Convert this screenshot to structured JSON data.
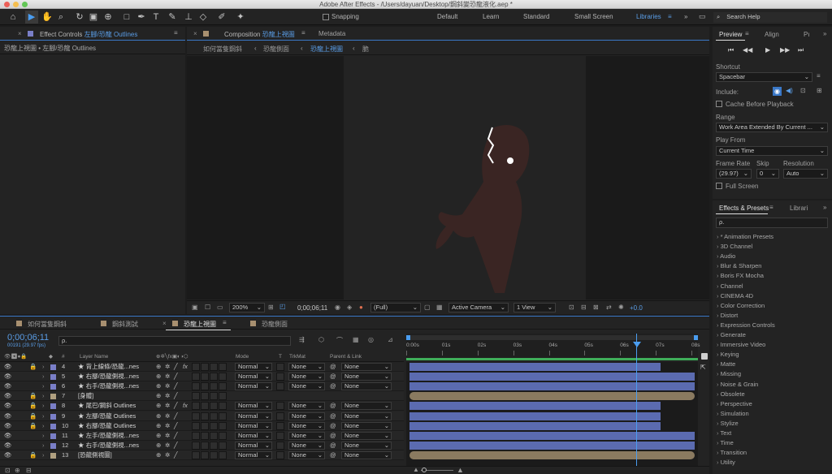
{
  "window_title": "Adobe After Effects - /Users/dayuan/Desktop/鋼斜變恐龍液化.aep *",
  "toolbar": {
    "snapping": "Snapping",
    "workspaces": [
      "Default",
      "Learn",
      "Standard",
      "Small Screen",
      "Libraries"
    ],
    "active_workspace": "Libraries",
    "search_help": "Search Help"
  },
  "effect_controls": {
    "tab_prefix": "Effect Controls",
    "tab_name": "左腳/恐龍 Outlines",
    "subtitle": "恐龍上視圖 • 左腳/恐龍 Outlines"
  },
  "composition": {
    "tab_prefix": "Composition",
    "tab_name": "恐龍上視圖",
    "metadata_tab": "Metadata",
    "crumbs": [
      "如何當隻鋼斜",
      "恐龍側面",
      "恐龍上視圖",
      "脆"
    ],
    "zoom": "200%",
    "timecode": "0;00;06;11",
    "resolution": "(Full)",
    "camera": "Active Camera",
    "views": "1 View",
    "exposure": "+0.0"
  },
  "timeline": {
    "tabs": [
      "如何當隻鋼斜",
      "鋼斜測試",
      "恐龍上視圖",
      "恐龍側面"
    ],
    "active_tab": "恐龍上視圖",
    "current_time": "0;00;06;11",
    "fps_info": "00191 (29.97 fps)",
    "search_placeholder": "ρ.",
    "headers": {
      "num": "#",
      "layer_name": "Layer Name",
      "mode": "Mode",
      "t": "T",
      "trkmat": "TrkMat",
      "parent": "Parent & Link"
    },
    "ruler": [
      "0:00s",
      "01s",
      "02s",
      "03s",
      "04s",
      "05s",
      "06s",
      "07s",
      "08s"
    ],
    "layers": [
      {
        "num": "4",
        "name": "★ 背上線條/恐龍...nes",
        "mode": "Normal",
        "trkmat": "None",
        "parent": "None",
        "lock": true,
        "fx": true,
        "color": "#7a7fc8",
        "bar_end": 0.88,
        "bar_color": "#5b6bb0"
      },
      {
        "num": "5",
        "name": "★ 右腳/恐龍側視...nes",
        "mode": "Normal",
        "trkmat": "None",
        "parent": "None",
        "lock": false,
        "fx": false,
        "color": "#7a7fc8",
        "bar_end": 1.0,
        "bar_color": "#5b6bb0"
      },
      {
        "num": "6",
        "name": "★ 右手/恐龍側視...nes",
        "mode": "Normal",
        "trkmat": "None",
        "parent": "None",
        "lock": false,
        "fx": false,
        "color": "#7a7fc8",
        "bar_end": 1.0,
        "bar_color": "#5b6bb0"
      },
      {
        "num": "7",
        "name": "[身體]",
        "mode": "",
        "trkmat": "",
        "parent": "",
        "lock": true,
        "fx": false,
        "color": "#b0a080",
        "bar_end": 1.0,
        "bar_color": "#8a7a60"
      },
      {
        "num": "8",
        "name": "★ 尾巴/鋼斜 Outlines",
        "mode": "Normal",
        "trkmat": "None",
        "parent": "None",
        "lock": true,
        "fx": true,
        "color": "#7a7fc8",
        "bar_end": 0.88,
        "bar_color": "#5b6bb0"
      },
      {
        "num": "9",
        "name": "★ 左腳/恐龍 Outlines",
        "mode": "Normal",
        "trkmat": "None",
        "parent": "None",
        "lock": true,
        "fx": false,
        "color": "#7a7fc8",
        "bar_end": 0.88,
        "bar_color": "#5b6bb0"
      },
      {
        "num": "10",
        "name": "★ 右腳/恐龍 Outlines",
        "mode": "Normal",
        "trkmat": "None",
        "parent": "None",
        "lock": true,
        "fx": false,
        "color": "#7a7fc8",
        "bar_end": 0.88,
        "bar_color": "#5b6bb0"
      },
      {
        "num": "11",
        "name": "★ 左手/恐龍側視...nes",
        "mode": "Normal",
        "trkmat": "None",
        "parent": "None",
        "lock": false,
        "fx": false,
        "color": "#7a7fc8",
        "bar_end": 1.0,
        "bar_color": "#5b6bb0"
      },
      {
        "num": "12",
        "name": "★ 右手/恐龍側視...nes",
        "mode": "Normal",
        "trkmat": "None",
        "parent": "None",
        "lock": false,
        "fx": false,
        "color": "#7a7fc8",
        "bar_end": 1.0,
        "bar_color": "#5b6bb0"
      },
      {
        "num": "13",
        "name": "[恐龍側視圖]",
        "mode": "Normal",
        "trkmat": "None",
        "parent": "None",
        "lock": true,
        "fx": false,
        "color": "#b0a080",
        "bar_end": 1.0,
        "bar_color": "#8a7a60"
      }
    ]
  },
  "preview": {
    "tabs": [
      "Preview",
      "Align",
      "Pı"
    ],
    "shortcut_label": "Shortcut",
    "shortcut": "Spacebar",
    "include_label": "Include:",
    "cache": "Cache Before Playback",
    "range_label": "Range",
    "range": "Work Area Extended By Current ...",
    "playfrom_label": "Play From",
    "playfrom": "Current Time",
    "framerate_label": "Frame Rate",
    "skip_label": "Skip",
    "resolution_label": "Resolution",
    "framerate": "(29.97)",
    "skip": "0",
    "resolution": "Auto",
    "fullscreen": "Full Screen"
  },
  "effects": {
    "tabs": [
      "Effects & Presets",
      "Librari"
    ],
    "search": "ρ.",
    "items": [
      "* Animation Presets",
      "3D Channel",
      "Audio",
      "Blur & Sharpen",
      "Boris FX Mocha",
      "Channel",
      "CINEMA 4D",
      "Color Correction",
      "Distort",
      "Expression Controls",
      "Generate",
      "Immersive Video",
      "Keying",
      "Matte",
      "Missing",
      "Noise & Grain",
      "Obsolete",
      "Perspective",
      "Simulation",
      "Stylize",
      "Text",
      "Time",
      "Transition",
      "Utility"
    ]
  }
}
